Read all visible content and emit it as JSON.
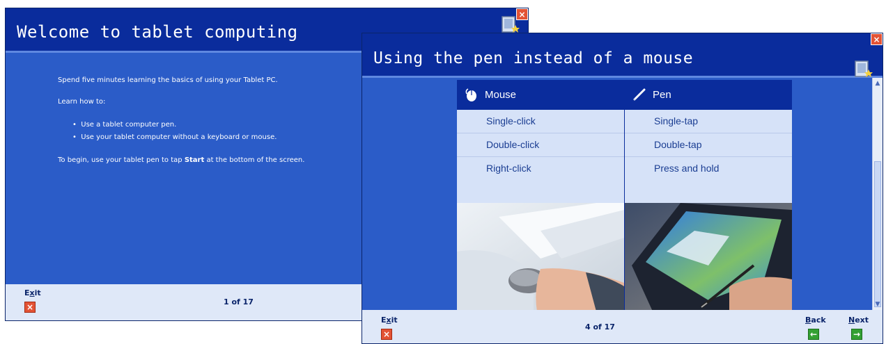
{
  "window1": {
    "title": "Welcome to tablet computing",
    "intro": "Spend five minutes learning the basics of using your Tablet PC.",
    "learn_how": "Learn how to:",
    "bullets": [
      "Use a tablet computer pen.",
      "Use your tablet computer without a keyboard or mouse."
    ],
    "begin_prefix": "To begin, use your tablet pen to tap ",
    "begin_bold": "Start",
    "begin_suffix": " at the bottom of the screen.",
    "exit_label_pre": "E",
    "exit_label_u": "x",
    "exit_label_post": "it",
    "page": "1 of 17",
    "close_glyph": "×"
  },
  "window2": {
    "title": "Using the pen instead of a mouse",
    "mouse_header": "Mouse",
    "pen_header": "Pen",
    "mouse_actions": [
      "Single-click",
      "Double-click",
      "Right-click"
    ],
    "pen_actions": [
      "Single-tap",
      "Double-tap",
      "Press and hold"
    ],
    "exit_label_pre": "E",
    "exit_label_u": "x",
    "exit_label_post": "it",
    "page": "4 of 17",
    "back_label_u": "B",
    "back_label_post": "ack",
    "next_label_u": "N",
    "next_label_post": "ext",
    "close_glyph": "×",
    "exit_glyph": "×",
    "back_glyph": "←",
    "next_glyph": "→"
  },
  "icons": {
    "close": "close-icon",
    "app": "tablet-tour-icon",
    "mouse": "mouse-icon",
    "pen": "pen-icon",
    "exit": "exit-icon",
    "back": "back-arrow-icon",
    "next": "next-arrow-icon"
  },
  "colors": {
    "title_bar": "#0a2c9c",
    "body": "#2b5cc8",
    "footer": "#dfe8f8",
    "exit_red": "#e35335",
    "nav_green": "#33a033"
  }
}
